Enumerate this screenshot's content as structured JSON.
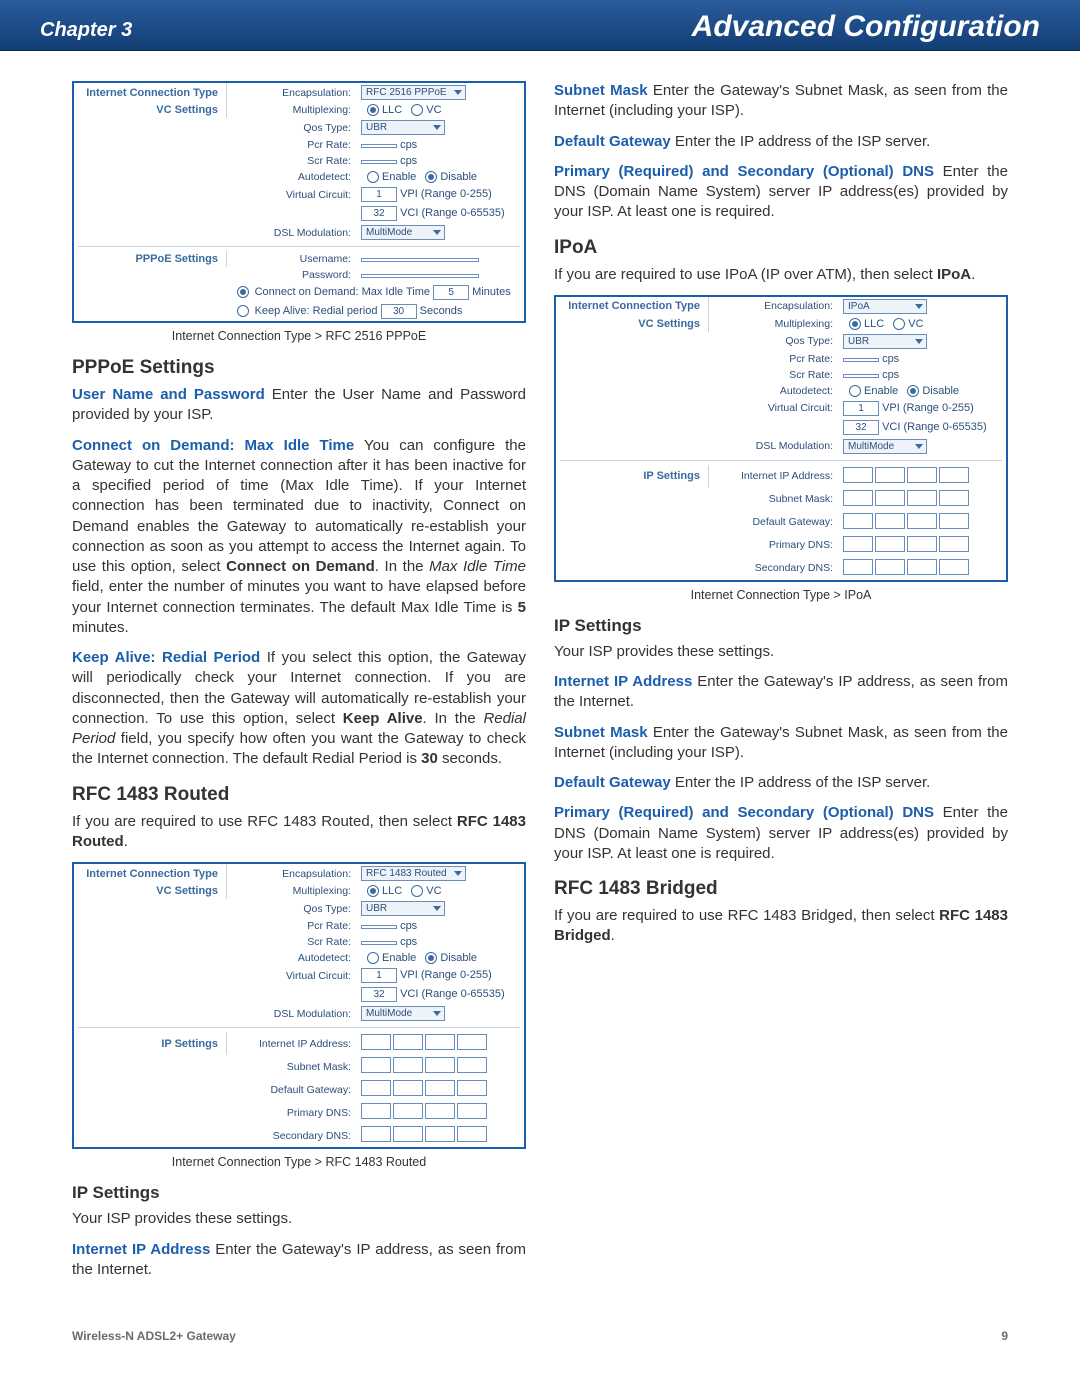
{
  "header": {
    "chapter": "Chapter 3",
    "title": "Advanced Configuration"
  },
  "footer": {
    "product": "Wireless-N ADSL2+ Gateway",
    "page": "9"
  },
  "shot_labels": {
    "internet_conn_type": "Internet Connection Type",
    "vc_settings": "VC Settings",
    "pppoe_settings": "PPPoE Settings",
    "ip_settings": "IP Settings",
    "encapsulation": "Encapsulation:",
    "multiplexing": "Multiplexing:",
    "qos_type": "Qos Type:",
    "pcr_rate": "Pcr Rate:",
    "scr_rate": "Scr Rate:",
    "autodetect": "Autodetect:",
    "virtual_circuit": "Virtual Circuit:",
    "dsl_modulation": "DSL Modulation:",
    "username": "Username:",
    "password": "Password:",
    "internet_ip": "Internet IP Address:",
    "subnet_mask": "Subnet Mask:",
    "default_gw": "Default Gateway:",
    "primary_dns": "Primary DNS:",
    "secondary_dns": "Secondary DNS:",
    "llc": "LLC",
    "vc": "VC",
    "enable": "Enable",
    "disable": "Disable",
    "vpi_range": "VPI (Range 0-255)",
    "vci_range": "VCI (Range 0-65535)",
    "cps": "cps",
    "connect_demand": "Connect on Demand: Max Idle Time",
    "keep_alive": "Keep Alive: Redial period",
    "minutes": "Minutes",
    "seconds": "Seconds"
  },
  "shot_vals": {
    "encap_pppoe": "RFC 2516 PPPoE",
    "encap_routed": "RFC 1483 Routed",
    "encap_ipoa": "IPoA",
    "qos": "UBR",
    "dsl_mod": "MultiMode",
    "vpi": "1",
    "vci": "32",
    "demand_min": "5",
    "redial_sec": "30"
  },
  "captions": {
    "pppoe": "Internet Connection Type > RFC 2516 PPPoE",
    "routed": "Internet Connection Type > RFC 1483 Routed",
    "ipoa": "Internet Connection Type > IPoA"
  },
  "headings": {
    "pppoe_settings": "PPPoE Settings",
    "rfc1483_routed": "RFC 1483 Routed",
    "ip_settings": "IP Settings",
    "ipoa": "IPoA",
    "rfc1483_bridged": "RFC 1483 Bridged"
  },
  "text": {
    "user_pass_term": "User Name and Password",
    "user_pass_body": " Enter the User Name and Password provided by your ISP.",
    "cod_term": "Connect on Demand: Max Idle Time",
    "cod_b1": " You can configure the Gateway to cut the Internet connection after it has been inactive for a specified period of time (Max Idle Time). If your Internet connection has been terminated due to inactivity, Connect on Demand enables the Gateway to automatically re-establish your connection as soon as you attempt to access the Internet again. To use this option, select ",
    "cod_b2": "Connect on Demand",
    "cod_b3": ". In the ",
    "cod_b4": "Max Idle Time",
    "cod_b5": " field, enter the number of minutes you want to have elapsed before your Internet connection terminates. The default Max Idle Time is ",
    "cod_b6": "5",
    "cod_b7": " minutes.",
    "ka_term": "Keep Alive: Redial Period",
    "ka_b1": " If you select this option, the Gateway will periodically check your Internet connection. If you are disconnected, then the Gateway will automatically re-establish your connection. To use this option, select ",
    "ka_b2": "Keep Alive",
    "ka_b3": ". In the ",
    "ka_b4": "Redial Period",
    "ka_b5": " field, you specify how often you want the Gateway to check the Internet connection. The default Redial Period is ",
    "ka_b6": "30",
    "ka_b7": " seconds.",
    "routed_intro_a": "If you are required to use RFC 1483 Routed, then select ",
    "routed_intro_b": "RFC 1483 Routed",
    "routed_intro_c": ".",
    "isp_provides": "Your ISP provides these settings.",
    "iip_term": "Internet IP Address",
    "iip_body": " Enter the Gateway's IP address, as seen from the Internet.",
    "sm_term": "Subnet Mask",
    "sm_body": " Enter the Gateway's Subnet Mask, as seen from the Internet (including your ISP).",
    "dg_term": "Default Gateway",
    "dg_body": " Enter the IP address of the ISP server.",
    "dns_term": "Primary (Required) and Secondary (Optional) DNS",
    "dns_body": " Enter the DNS (Domain Name System) server IP address(es) provided by your ISP. At least one is required.",
    "ipoa_intro_a": "If you are required to use IPoA (IP over ATM), then select ",
    "ipoa_intro_b": "IPoA",
    "ipoa_intro_c": ".",
    "bridged_intro_a": "If you are required to use RFC 1483 Bridged, then select ",
    "bridged_intro_b": "RFC 1483 Bridged",
    "bridged_intro_c": "."
  }
}
